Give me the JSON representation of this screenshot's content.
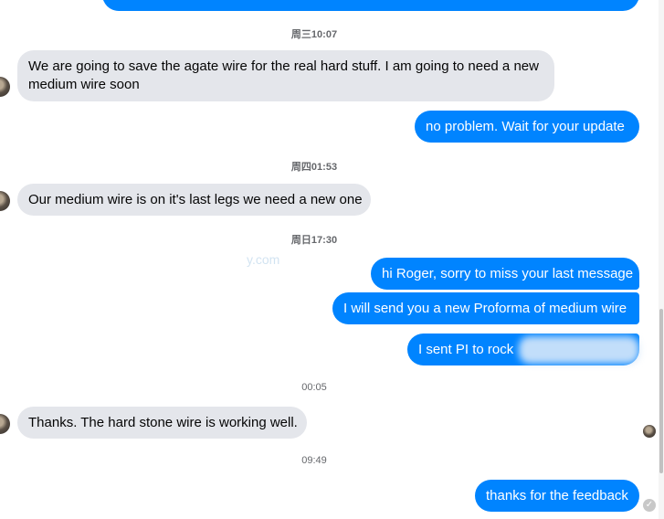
{
  "timestamps": {
    "t1": "周三10:07",
    "t2": "周四01:53",
    "t3": "周日17:30",
    "t4": "00:05",
    "t5": "09:49"
  },
  "messages": {
    "m1_line1": "We are going to save the agate wire for the real hard stuff.  I am going to need a new",
    "m1_line2": "medium wire soon",
    "m2": "no problem. Wait for your update",
    "m3": "Our medium wire is on it's last legs we need a new one",
    "m4": "hi Roger, sorry to miss your last message",
    "m5": "I will send you a new Proforma of medium wire",
    "m6": "I sent PI to  rock",
    "m7": "Thanks.  The hard stone wire is working well.",
    "m8": "thanks for the feedback"
  },
  "watermark_text": "y.com",
  "icons": {
    "avatar": "avatar-icon",
    "seen": "check-circle-icon"
  },
  "colors": {
    "outgoing": "#0084ff",
    "incoming": "#e4e6eb",
    "timestamp": "#65676b"
  }
}
